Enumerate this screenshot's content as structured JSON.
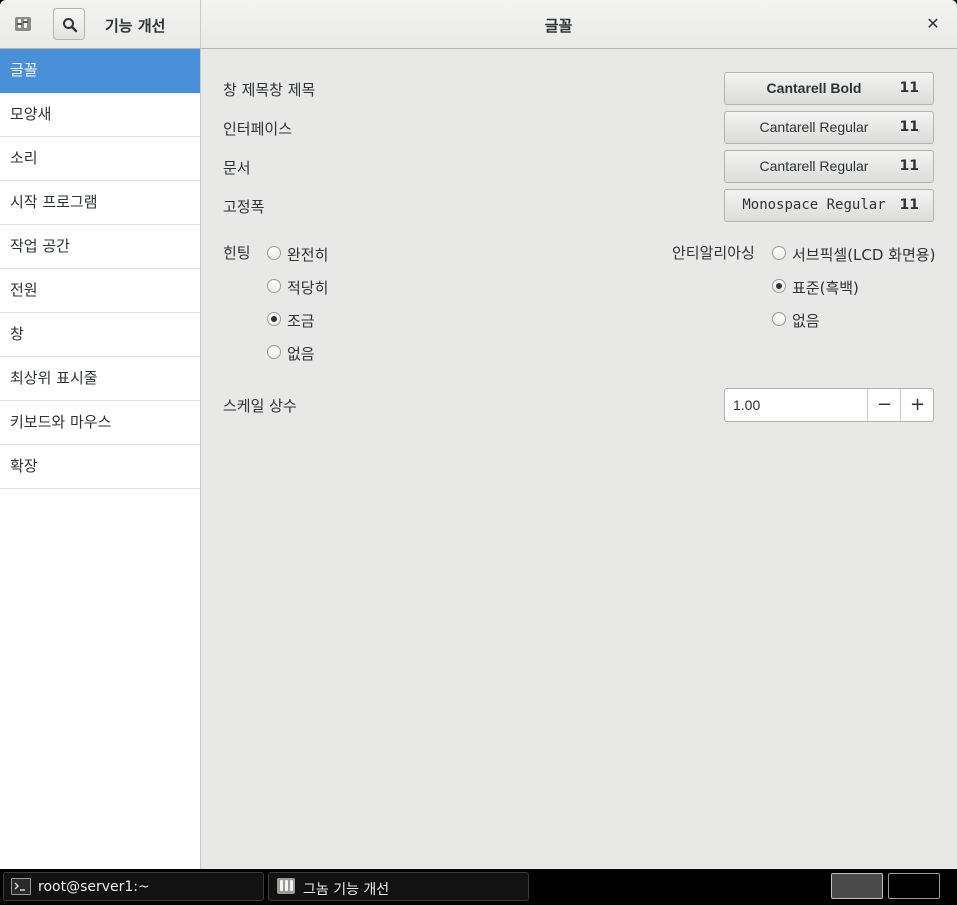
{
  "header": {
    "app_title": "기능 개선",
    "page_title": "글꼴",
    "close_symbol": "✕"
  },
  "sidebar": {
    "items": [
      {
        "label": "글꼴",
        "selected": true
      },
      {
        "label": "모양새"
      },
      {
        "label": "소리"
      },
      {
        "label": "시작 프로그램"
      },
      {
        "label": "작업 공간"
      },
      {
        "label": "전원"
      },
      {
        "label": "창"
      },
      {
        "label": "최상위 표시줄"
      },
      {
        "label": "키보드와 마우스"
      },
      {
        "label": "확장"
      }
    ]
  },
  "fonts": {
    "rows": [
      {
        "label": "창 제목창 제목",
        "font": "Cantarell Bold",
        "size": "11"
      },
      {
        "label": "인터페이스",
        "font": "Cantarell Regular",
        "size": "11"
      },
      {
        "label": "문서",
        "font": "Cantarell Regular",
        "size": "11"
      },
      {
        "label": "고정폭",
        "font": "Monospace Regular",
        "size": "11"
      }
    ]
  },
  "hinting": {
    "label": "힌팅",
    "options": [
      "완전히",
      "적당히",
      "조금",
      "없음"
    ],
    "selected": "조금"
  },
  "antialiasing": {
    "label": "안티알리아싱",
    "options": [
      "서브픽셀(LCD 화면용)",
      "표준(흑백)",
      "없음"
    ],
    "selected": "표준(흑백)"
  },
  "scale": {
    "label": "스케일 상수",
    "value": "1.00",
    "minus": "−",
    "plus": "+"
  },
  "taskbar": {
    "tasks": [
      "root@server1:~",
      "그놈 기능 개선"
    ]
  },
  "colors": {
    "selection": "#4a90d9",
    "window_bg": "#e8e8e7",
    "taskbar_bg": "#000000"
  }
}
